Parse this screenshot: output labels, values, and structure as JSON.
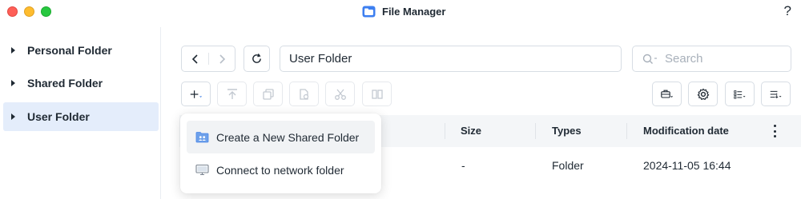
{
  "window": {
    "title": "File Manager",
    "help_label": "?"
  },
  "sidebar": {
    "items": [
      {
        "label": "Personal Folder",
        "active": false
      },
      {
        "label": "Shared Folder",
        "active": false
      },
      {
        "label": "User Folder",
        "active": true
      }
    ]
  },
  "toolbar": {
    "path_value": "User Folder",
    "search_placeholder": "Search"
  },
  "table": {
    "columns": [
      "Size",
      "Types",
      "Modification date"
    ],
    "rows": [
      {
        "size": "-",
        "type": "Folder",
        "modified": "2024-11-05 16:44"
      }
    ]
  },
  "create_menu": {
    "items": [
      {
        "label": "Create a New Shared Folder",
        "icon": "shared-folder-icon"
      },
      {
        "label": "Connect to network folder",
        "icon": "monitor-icon"
      }
    ]
  },
  "colors": {
    "accent": "#4a86e8",
    "active_bg": "#e4edfb",
    "header_bg": "#f4f6f8"
  }
}
